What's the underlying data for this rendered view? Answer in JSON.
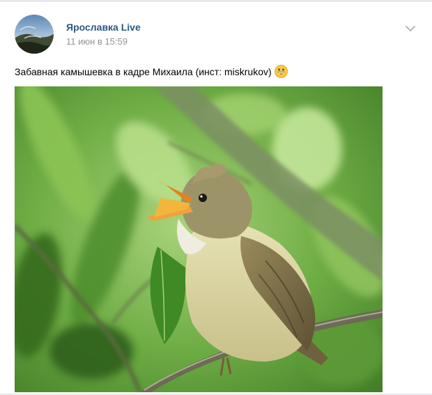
{
  "post": {
    "author": "Ярославка Live",
    "date": "11 июн в 15:59",
    "text": "Забавная камышевка в кадре Михаила (инст: miskrukov)",
    "emoji": "grinning-face-emoji"
  },
  "icons": {
    "menu": "chevron-down-icon"
  },
  "colors": {
    "author_link": "#2a5885",
    "date": "#939393",
    "text": "#000000",
    "divider": "#e7e8ec"
  }
}
